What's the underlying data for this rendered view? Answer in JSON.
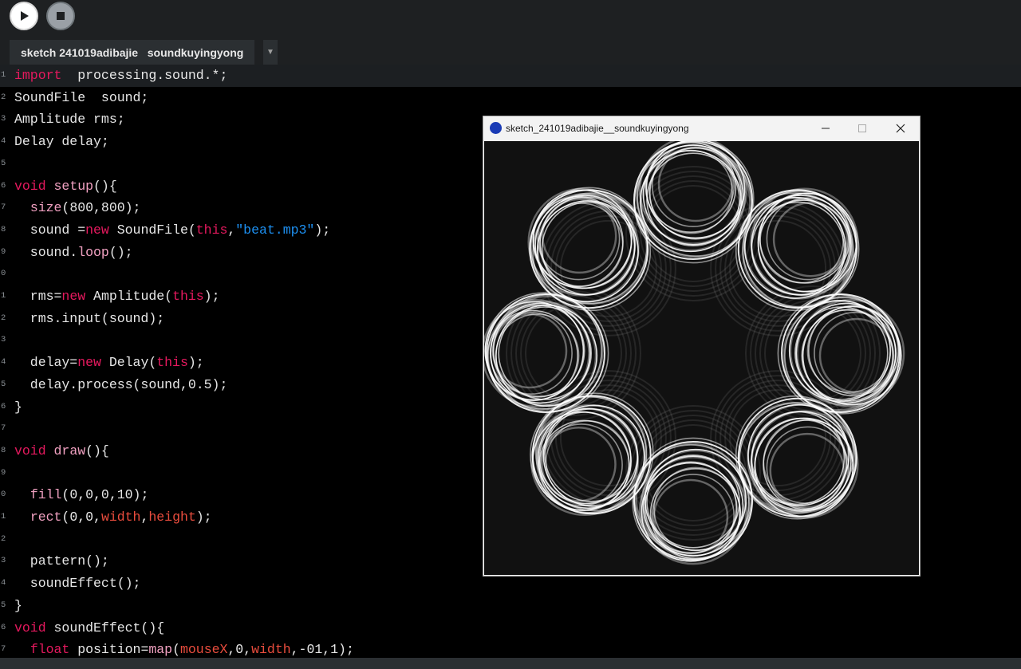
{
  "toolbar": {
    "run_icon": "play-icon",
    "stop_icon": "stop-icon"
  },
  "tab": {
    "label": "sketch 241019adibajie   soundkuyingyong",
    "menu_icon": "chevron-down-icon"
  },
  "window": {
    "title": "sketch_241019adibajie__soundkuyingyong"
  },
  "code_lines": [
    {
      "ln": "1",
      "hl": true,
      "tokens": [
        [
          "kw",
          "import"
        ],
        [
          "",
          "  processing.sound.*;"
        ]
      ]
    },
    {
      "ln": "2",
      "tokens": [
        [
          "",
          "SoundFile  sound;"
        ]
      ]
    },
    {
      "ln": "3",
      "tokens": [
        [
          "",
          "Amplitude rms;"
        ]
      ]
    },
    {
      "ln": "4",
      "tokens": [
        [
          "",
          "Delay delay;"
        ]
      ]
    },
    {
      "ln": "5",
      "tokens": []
    },
    {
      "ln": "6",
      "tokens": [
        [
          "kw",
          "void"
        ],
        [
          "",
          " "
        ],
        [
          "fn",
          "setup"
        ],
        [
          "",
          "(){"
        ]
      ]
    },
    {
      "ln": "7",
      "tokens": [
        [
          "",
          "  "
        ],
        [
          "fn",
          "size"
        ],
        [
          "",
          "(800,800);"
        ]
      ]
    },
    {
      "ln": "8",
      "tokens": [
        [
          "",
          "  sound ="
        ],
        [
          "kw",
          "new"
        ],
        [
          "",
          " SoundFile("
        ],
        [
          "kw",
          "this"
        ],
        [
          "",
          ","
        ],
        [
          "str",
          "\"beat.mp3\""
        ],
        [
          "",
          ");"
        ]
      ]
    },
    {
      "ln": "9",
      "tokens": [
        [
          "",
          "  sound."
        ],
        [
          "fn",
          "loop"
        ],
        [
          "",
          "();"
        ]
      ]
    },
    {
      "ln": "0",
      "tokens": []
    },
    {
      "ln": "1",
      "tokens": [
        [
          "",
          "  rms="
        ],
        [
          "kw",
          "new"
        ],
        [
          "",
          " Amplitude("
        ],
        [
          "kw",
          "this"
        ],
        [
          "",
          ");"
        ]
      ]
    },
    {
      "ln": "2",
      "tokens": [
        [
          "",
          "  rms.input(sound);"
        ]
      ]
    },
    {
      "ln": "3",
      "tokens": []
    },
    {
      "ln": "4",
      "tokens": [
        [
          "",
          "  delay="
        ],
        [
          "kw",
          "new"
        ],
        [
          "",
          " Delay("
        ],
        [
          "kw",
          "this"
        ],
        [
          "",
          ");"
        ]
      ]
    },
    {
      "ln": "5",
      "tokens": [
        [
          "",
          "  delay.process(sound,0.5);"
        ]
      ]
    },
    {
      "ln": "6",
      "tokens": [
        [
          "",
          "}"
        ]
      ]
    },
    {
      "ln": "7",
      "tokens": []
    },
    {
      "ln": "8",
      "tokens": [
        [
          "kw",
          "void"
        ],
        [
          "",
          " "
        ],
        [
          "fn",
          "draw"
        ],
        [
          "",
          "(){"
        ]
      ]
    },
    {
      "ln": "9",
      "tokens": []
    },
    {
      "ln": "0",
      "tokens": [
        [
          "",
          "  "
        ],
        [
          "fn",
          "fill"
        ],
        [
          "",
          "(0,0,0,10);"
        ]
      ]
    },
    {
      "ln": "1",
      "tokens": [
        [
          "",
          "  "
        ],
        [
          "fn",
          "rect"
        ],
        [
          "",
          "(0,0,"
        ],
        [
          "bi",
          "width"
        ],
        [
          "",
          ","
        ],
        [
          "bi",
          "height"
        ],
        [
          "",
          ");"
        ]
      ]
    },
    {
      "ln": "2",
      "tokens": []
    },
    {
      "ln": "3",
      "tokens": [
        [
          "",
          "  pattern();"
        ]
      ]
    },
    {
      "ln": "4",
      "tokens": [
        [
          "",
          "  soundEffect();"
        ]
      ]
    },
    {
      "ln": "5",
      "tokens": [
        [
          "",
          "}"
        ]
      ]
    },
    {
      "ln": "6",
      "tokens": [
        [
          "kw",
          "void"
        ],
        [
          "",
          " soundEffect(){"
        ]
      ]
    },
    {
      "ln": "7",
      "tokens": [
        [
          "",
          "  "
        ],
        [
          "kw",
          "float"
        ],
        [
          "",
          " position="
        ],
        [
          "fn",
          "map"
        ],
        [
          "",
          "("
        ],
        [
          "bi",
          "mouseX"
        ],
        [
          "",
          ",0,"
        ],
        [
          "bi",
          "width"
        ],
        [
          "",
          ",-01,1);"
        ]
      ]
    }
  ],
  "colors": {
    "keyword": "#e5195e",
    "function": "#f0a0c0",
    "string": "#1d8ff0",
    "builtin": "#e84c3d"
  }
}
